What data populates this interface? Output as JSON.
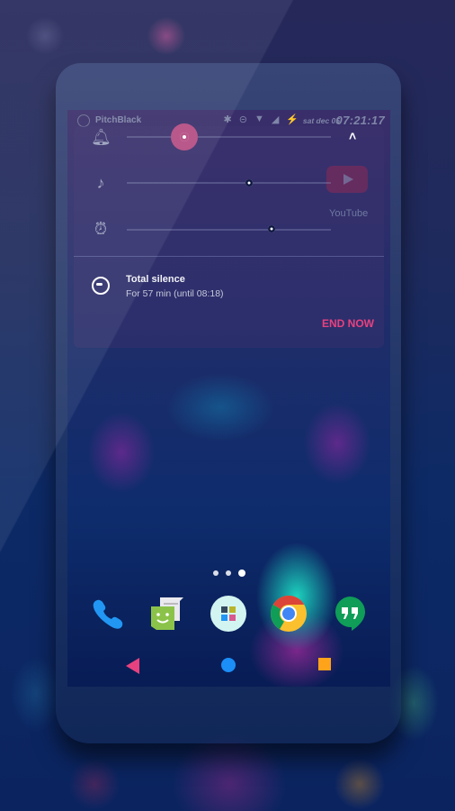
{
  "status_bar": {
    "carrier_label": "PitchBlack",
    "icons": [
      "bluetooth-icon",
      "do-not-disturb-icon",
      "wifi-icon",
      "no-signal-icon",
      "battery-charging-icon"
    ],
    "date": "sat dec 05",
    "time": "07:21:17"
  },
  "volume_panel": {
    "sliders": [
      {
        "name": "ringer",
        "icon": "bell-icon",
        "value_percent": 28,
        "active": true
      },
      {
        "name": "media",
        "icon": "music-note-icon",
        "value_percent": 60,
        "active": false
      },
      {
        "name": "alarm",
        "icon": "alarm-clock-icon",
        "value_percent": 71,
        "active": false
      }
    ],
    "collapse_icon": "chevron-up-icon",
    "accent_color": "#b44b82"
  },
  "background_app": {
    "label": "YouTube"
  },
  "dnd": {
    "title": "Total silence",
    "subtitle": "For 57 min (until 08:18)",
    "action_label": "END NOW",
    "action_color": "#e8417f"
  },
  "home": {
    "page_indicator": {
      "pages": 3,
      "current": 3
    },
    "dock": [
      {
        "name": "Phone",
        "icon": "phone-icon"
      },
      {
        "name": "Messenger",
        "icon": "messenger-icon"
      },
      {
        "name": "App drawer",
        "icon": "app-drawer-icon"
      },
      {
        "name": "Chrome",
        "icon": "chrome-icon"
      },
      {
        "name": "Hangouts",
        "icon": "hangouts-icon"
      }
    ]
  },
  "nav_bar": {
    "back_color": "#e8417f",
    "home_color": "#1b8ef7",
    "recents_color": "#ffa31a"
  }
}
